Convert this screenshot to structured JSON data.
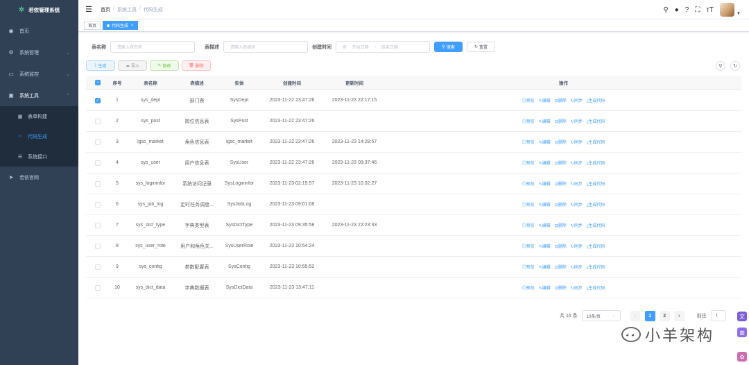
{
  "brand": {
    "title": "若依管理系统"
  },
  "sidebar": {
    "items": [
      {
        "label": "首页"
      },
      {
        "label": "系统管理"
      },
      {
        "label": "系统监控"
      },
      {
        "label": "系统工具"
      },
      {
        "label": "若依官网"
      }
    ],
    "sub": [
      {
        "label": "表单构建"
      },
      {
        "label": "代码生成"
      },
      {
        "label": "系统接口"
      }
    ]
  },
  "breadcrumb": {
    "home": "首页",
    "sep": "/",
    "tool": "系统工具",
    "current": "代码生成"
  },
  "tags": {
    "home": "首页",
    "active": "代码生成"
  },
  "search": {
    "table_name_label": "表名称",
    "table_name_placeholder": "请输入表名称",
    "table_desc_label": "表描述",
    "table_desc_placeholder": "请输入表描述",
    "created_label": "创建时间",
    "start_placeholder": "开始日期",
    "range_sep": "-",
    "end_placeholder": "结束日期",
    "search_btn": "搜索",
    "reset_btn": "重置"
  },
  "toolbar": {
    "gen": "生成",
    "import": "导入",
    "edit": "修改",
    "delete": "删除"
  },
  "table": {
    "headers": [
      "序号",
      "表名称",
      "表描述",
      "实体",
      "创建时间",
      "更新时间",
      "操作"
    ],
    "ops": [
      "预览",
      "编辑",
      "删除",
      "同步",
      "生成代码"
    ],
    "rows": [
      {
        "no": "1",
        "name": "sys_dept",
        "desc": "部门表",
        "entity": "SysDept",
        "created": "2023-11-22 23:47:26",
        "updated": "2023-11-23 22:17:15",
        "checked": true
      },
      {
        "no": "2",
        "name": "sys_post",
        "desc": "岗位信息表",
        "entity": "SysPost",
        "created": "2023-11-22 23:47:26",
        "updated": "",
        "checked": false
      },
      {
        "no": "3",
        "name": "lgsc_market",
        "desc": "角色信息表",
        "entity": "lgsc_market",
        "created": "2023-11-22 23:47:26",
        "updated": "2023-11-23 14:28:57",
        "checked": false
      },
      {
        "no": "4",
        "name": "sys_user",
        "desc": "用户信息表",
        "entity": "SysUser",
        "created": "2023-11-22 23:47:26",
        "updated": "2023-11-23 09:37:46",
        "checked": false
      },
      {
        "no": "5",
        "name": "sys_logininfor",
        "desc": "系统访问记录",
        "entity": "SysLogininfor",
        "created": "2023-11-23 02:15:57",
        "updated": "2023-11-23 10:02:27",
        "checked": false
      },
      {
        "no": "6",
        "name": "sys_job_log",
        "desc": "定时任务调度...",
        "entity": "SysJobLog",
        "created": "2023-11-23 09:01:08",
        "updated": "",
        "checked": false
      },
      {
        "no": "7",
        "name": "sys_dict_type",
        "desc": "字典类型表",
        "entity": "SysDictType",
        "created": "2023-11-23 09:35:58",
        "updated": "2023-11-23 22:23:33",
        "checked": false
      },
      {
        "no": "8",
        "name": "sys_user_role",
        "desc": "用户和角色关...",
        "entity": "SysUserRole",
        "created": "2023-11-23 10:54:24",
        "updated": "",
        "checked": false
      },
      {
        "no": "9",
        "name": "sys_config",
        "desc": "参数配置表",
        "entity": "SysConfig",
        "created": "2023-11-23 10:55:52",
        "updated": "",
        "checked": false
      },
      {
        "no": "10",
        "name": "sys_dict_data",
        "desc": "字典数据表",
        "entity": "SysDictData",
        "created": "2023-11-23 13:47:11",
        "updated": "",
        "checked": false
      }
    ]
  },
  "pagination": {
    "total": "共 16 条",
    "size": "10条/页",
    "prev": "‹",
    "pages": [
      "1",
      "2"
    ],
    "next": "›",
    "goto": "前往",
    "goto_value": "1"
  },
  "watermark": {
    "text": "小羊架构"
  }
}
